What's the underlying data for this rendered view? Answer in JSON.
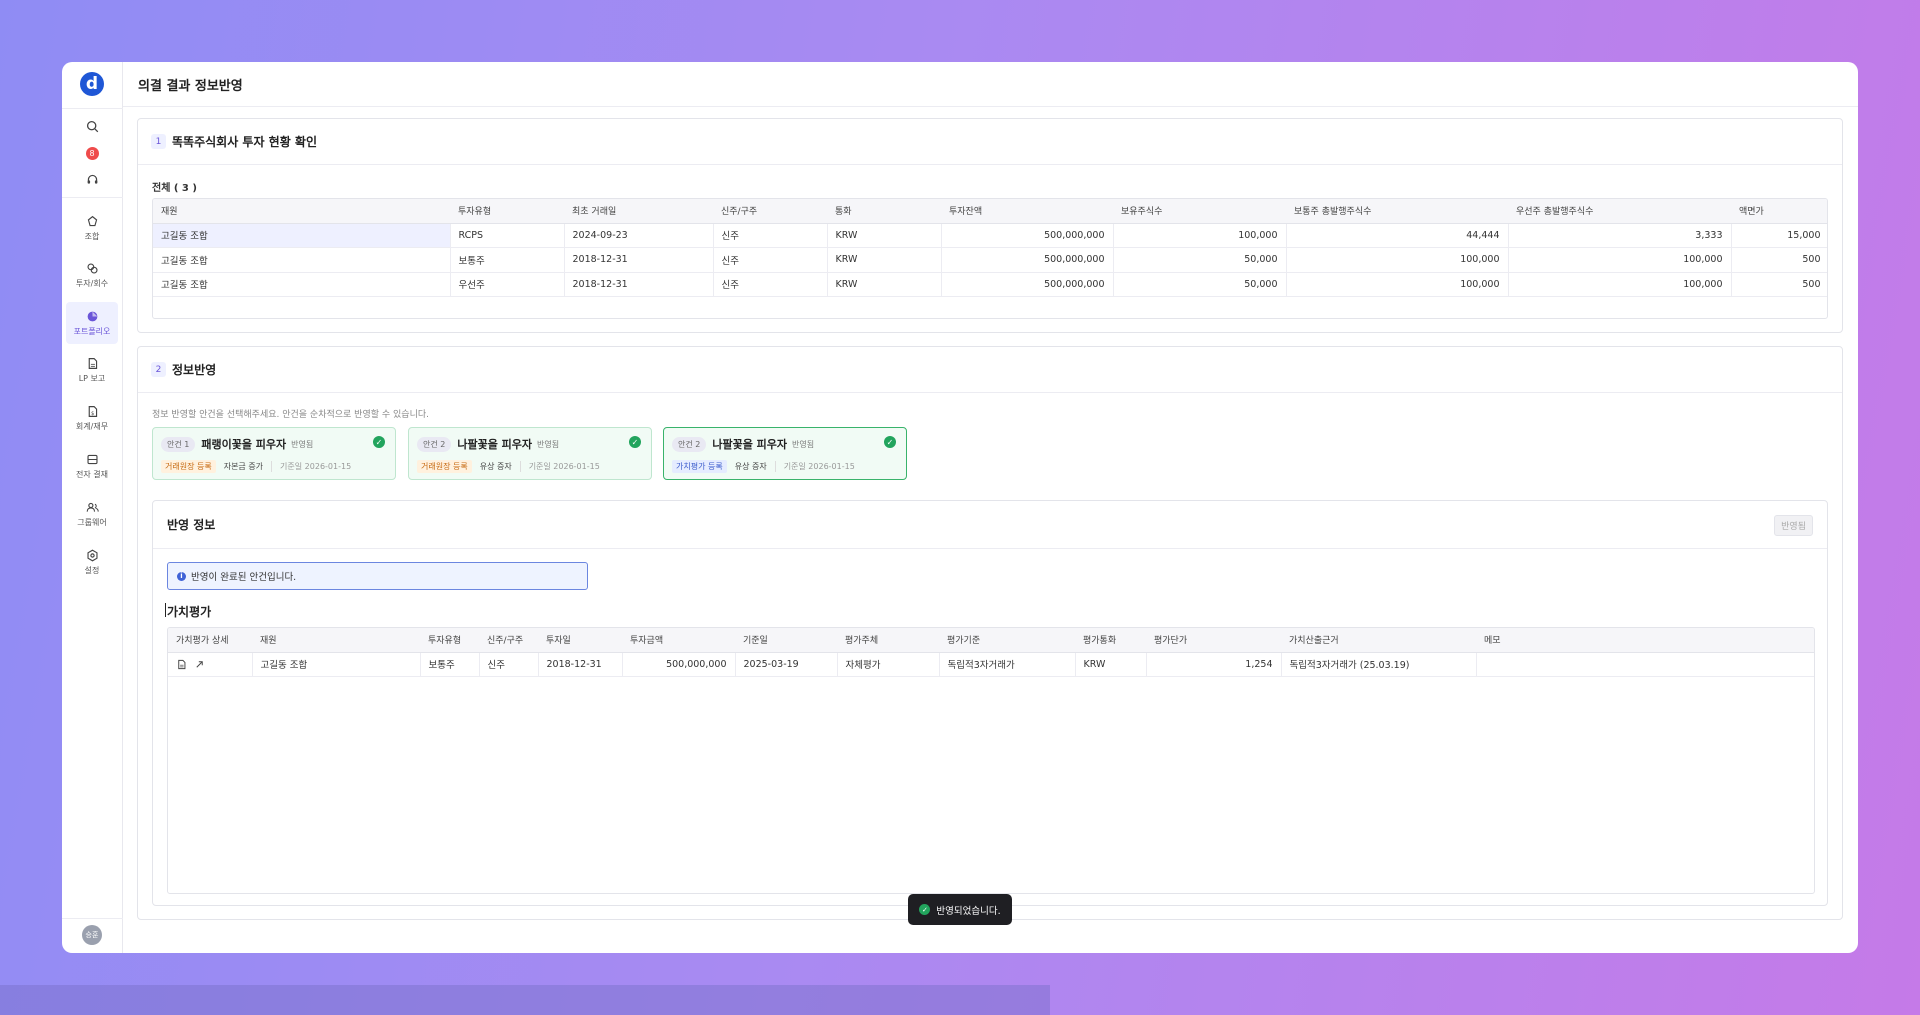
{
  "page": {
    "title": "의결 결과 정보반영"
  },
  "sidebar": {
    "logo": "d",
    "notification_count": "8",
    "items": [
      {
        "label": "조합",
        "icon": "fund-icon"
      },
      {
        "label": "투자/회수",
        "icon": "investment-icon"
      },
      {
        "label": "포트폴리오",
        "icon": "portfolio-icon"
      },
      {
        "label": "LP 보고",
        "icon": "report-icon"
      },
      {
        "label": "회계/재무",
        "icon": "accounting-icon"
      },
      {
        "label": "전자 결재",
        "icon": "approval-icon"
      },
      {
        "label": "그룹웨어",
        "icon": "groupware-icon"
      },
      {
        "label": "설정",
        "icon": "settings-icon"
      }
    ],
    "avatar": "승훈"
  },
  "section1": {
    "step": "1",
    "title": "똑똑주식회사 투자 현황 확인",
    "total_label": "전체 ( 3 )",
    "columns": [
      "재원",
      "투자유형",
      "최초 거래일",
      "신주/구주",
      "통화",
      "투자잔액",
      "보유주식수",
      "보통주 총발행주식수",
      "우선주 총발행주식수",
      "액면가"
    ],
    "rows": [
      [
        "고길동 조합",
        "RCPS",
        "2024-09-23",
        "신주",
        "KRW",
        "500,000,000",
        "100,000",
        "44,444",
        "3,333",
        "15,000"
      ],
      [
        "고길동 조합",
        "보통주",
        "2018-12-31",
        "신주",
        "KRW",
        "500,000,000",
        "50,000",
        "100,000",
        "100,000",
        "500"
      ],
      [
        "고길동 조합",
        "우선주",
        "2018-12-31",
        "신주",
        "KRW",
        "500,000,000",
        "50,000",
        "100,000",
        "100,000",
        "500"
      ]
    ]
  },
  "section2": {
    "step": "2",
    "title": "정보반영",
    "hint": "정보 반영할 안건을 선택해주세요. 안건을 순차적으로 반영할 수 있습니다.",
    "agendas": [
      {
        "pill": "안건 1",
        "name": "패랭이꽃을 피우자",
        "status": "반영됨",
        "tag": "거래원장 등록",
        "tag_color": "orange",
        "desc": "자본금 증가",
        "date": "기준일 2026-01-15"
      },
      {
        "pill": "안건 2",
        "name": "나팔꽃을 피우자",
        "status": "반영됨",
        "tag": "거래원장 등록",
        "tag_color": "orange",
        "desc": "유상 증자",
        "date": "기준일 2026-01-15"
      },
      {
        "pill": "안건 2",
        "name": "나팔꽃을 피우자",
        "status": "반영됨",
        "tag": "가치평가 등록",
        "tag_color": "blue",
        "desc": "유상 증자",
        "date": "기준일 2026-01-15"
      }
    ],
    "reflect": {
      "title": "반영 정보",
      "button": "반영됨",
      "info": "반영이 완료된 안건입니다.",
      "valuation_title": "가치평가",
      "columns": [
        "가치평가 상세",
        "재원",
        "투자유형",
        "신주/구주",
        "투자일",
        "투자금액",
        "기준일",
        "평가주체",
        "평가기준",
        "평가통화",
        "평가단가",
        "가치산출근거",
        "메모"
      ],
      "rows": [
        [
          "",
          "고길동 조합",
          "보통주",
          "신주",
          "2018-12-31",
          "500,000,000",
          "2025-03-19",
          "자체평가",
          "독립적3자거래가",
          "KRW",
          "1,254",
          "독립적3자거래가 (25.03.19)",
          ""
        ]
      ]
    }
  },
  "toast": "반영되었습니다."
}
